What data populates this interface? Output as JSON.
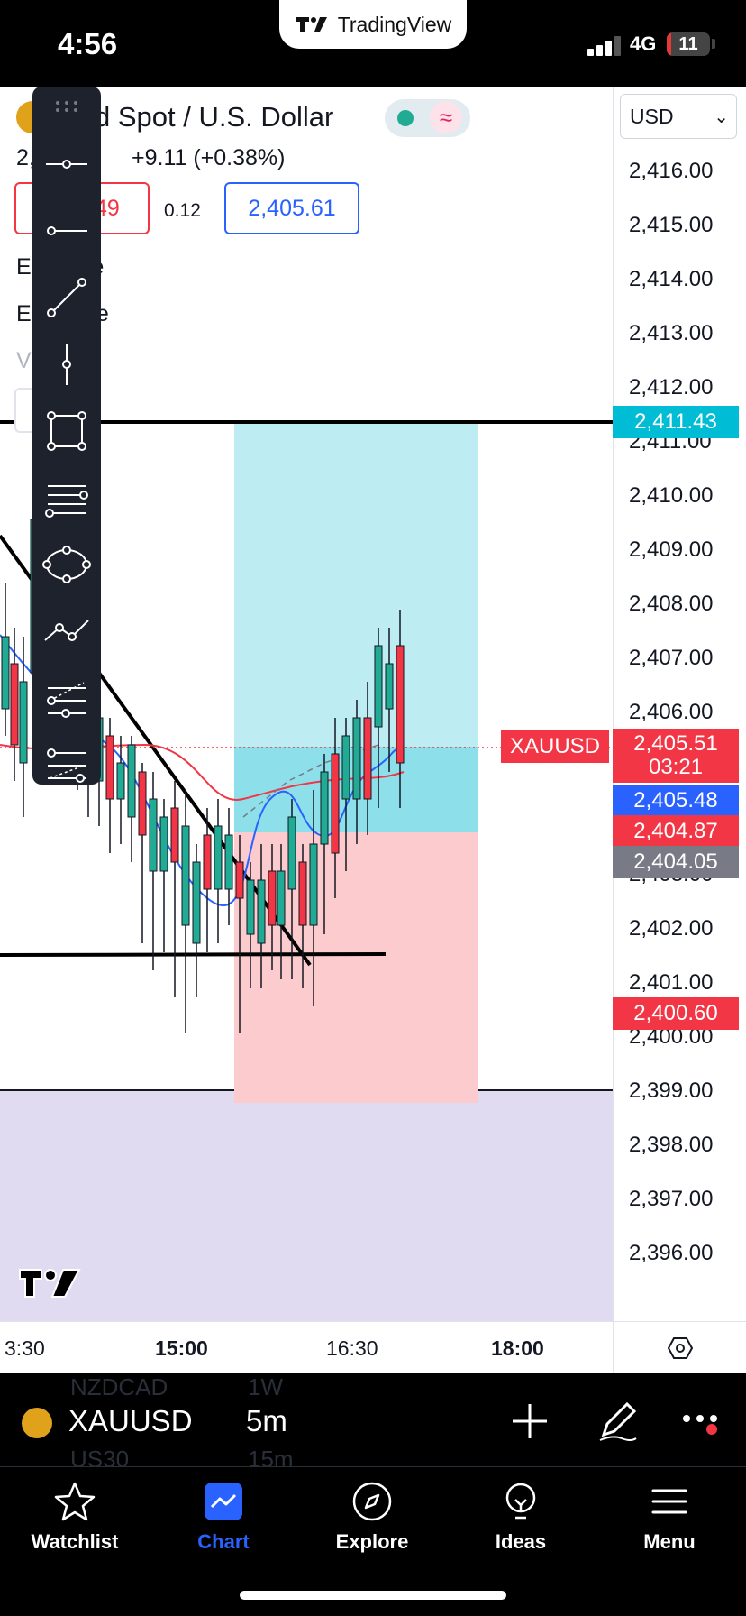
{
  "status_bar": {
    "time": "4:56",
    "app_pill": "TradingView",
    "network": "4G",
    "battery": "11",
    "battery_level": 0.11
  },
  "legend": {
    "symbol_title": "d Spot / U.S. Dollar",
    "price": "2,",
    "price_suffix": "51",
    "change": "+9.11 (+0.38%)",
    "bid": "449",
    "bid_prefix": "1",
    "spread": "0.12",
    "ask": "2,405.61",
    "ema1": "E  ) close",
    "ema2": "E  3 close",
    "volume": "V"
  },
  "currency": "USD",
  "price_axis": {
    "labels": [
      "2,416.00",
      "2,415.00",
      "2,414.00",
      "2,413.00",
      "2,412.00",
      "2,411.00",
      "2,410.00",
      "2,409.00",
      "2,408.00",
      "2,407.00",
      "2,406.00",
      "2,403.00",
      "2,402.00",
      "2,401.00",
      "2,400.00",
      "2,399.00",
      "2,398.00",
      "2,397.00",
      "2,396.00"
    ],
    "tags": [
      {
        "value": "2,411.43",
        "color": "#00bcd4"
      },
      {
        "value": "2,405.51",
        "sub": "03:21",
        "color": "#f23645"
      },
      {
        "value": "2,405.48",
        "color": "#2962ff"
      },
      {
        "value": "2,404.87",
        "color": "#f23645"
      },
      {
        "value": "2,404.05",
        "color": "#787b86"
      },
      {
        "value": "2,400.60",
        "color": "#f23645"
      }
    ],
    "symbol_tag": "XAUUSD"
  },
  "time_axis": [
    "3:30",
    "15:00",
    "16:30",
    "18:00"
  ],
  "symbol_bar": {
    "symbol": "XAUUSD",
    "interval": "5m",
    "ghost_symbol_1": "NZDCAD",
    "ghost_interval_1": "1W",
    "ghost_symbol_2": "US30",
    "ghost_interval_2": "15m"
  },
  "tabs": [
    {
      "label": "Watchlist",
      "icon": "star-icon",
      "active": false
    },
    {
      "label": "Chart",
      "icon": "chart-icon",
      "active": true
    },
    {
      "label": "Explore",
      "icon": "compass-icon",
      "active": false
    },
    {
      "label": "Ideas",
      "icon": "lightbulb-icon",
      "active": false
    },
    {
      "label": "Menu",
      "icon": "hamburger-icon",
      "active": false
    }
  ],
  "drawing_tools": [
    "horizontal-ray-icon",
    "ray-icon",
    "trend-line-icon",
    "vertical-line-icon",
    "rectangle-icon",
    "parallel-channel-icon",
    "ellipse-icon",
    "path-icon",
    "pitchfork-icon",
    "fib-channel-icon"
  ],
  "colors": {
    "accent": "#2962ff",
    "up": "#22ab94",
    "down": "#f23645",
    "profit_zone": "#b2ebf2",
    "loss_zone": "#fccbcd",
    "volume_pane": "#e1dbf1"
  }
}
